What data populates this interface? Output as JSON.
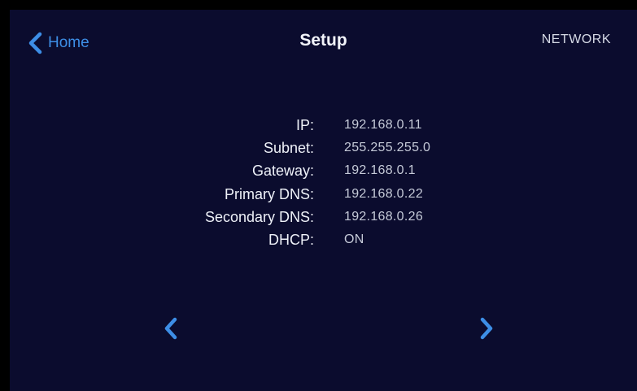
{
  "header": {
    "back_label": "Home",
    "title": "Setup",
    "section": "NETWORK"
  },
  "network": {
    "rows": [
      {
        "label": "IP:",
        "value": "192.168.0.11"
      },
      {
        "label": "Subnet:",
        "value": "255.255.255.0"
      },
      {
        "label": "Gateway:",
        "value": "192.168.0.1"
      },
      {
        "label": "Primary DNS:",
        "value": "192.168.0.22"
      },
      {
        "label": "Secondary DNS:",
        "value": "192.168.0.26"
      },
      {
        "label": "DHCP:",
        "value": "ON"
      }
    ]
  },
  "icons": {
    "back": "chevron-left-icon",
    "prev": "chevron-left-icon",
    "next": "chevron-right-icon"
  },
  "colors": {
    "background": "#0b0c2e",
    "accent": "#3d8ee6",
    "text": "#eef1f8"
  }
}
